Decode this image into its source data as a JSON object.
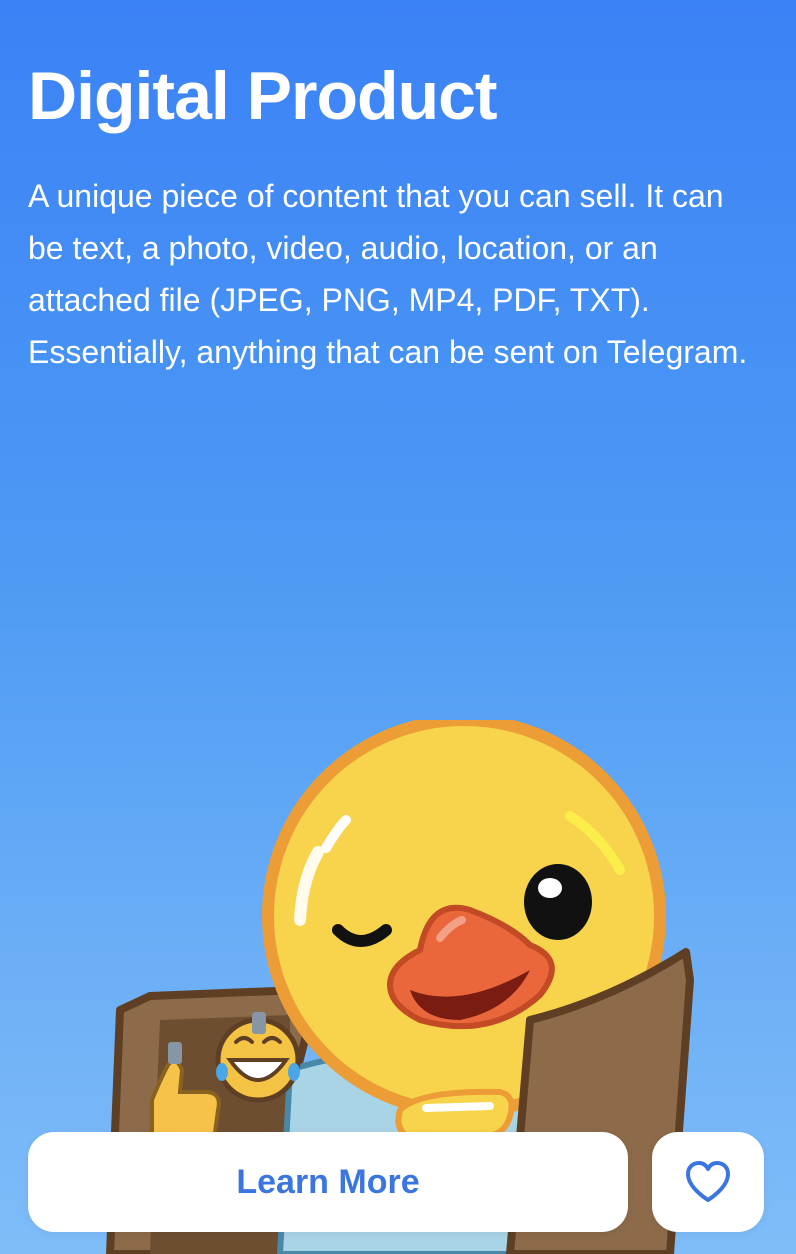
{
  "header": {
    "title": "Digital Product",
    "description": "A unique piece of content that you can sell. It can be text, a photo, video, audio, location, or an attached file (JPEG, PNG, MP4, PDF, TXT). Essentially, anything that can be sent on Telegram."
  },
  "illustration": {
    "icon": "duck-with-bag-illustration"
  },
  "actions": {
    "learn_more_label": "Learn More",
    "favorite_icon": "heart-icon"
  },
  "colors": {
    "background_top": "#3b82f6",
    "background_bottom": "#7fbdf8",
    "accent": "#3b76e0"
  }
}
